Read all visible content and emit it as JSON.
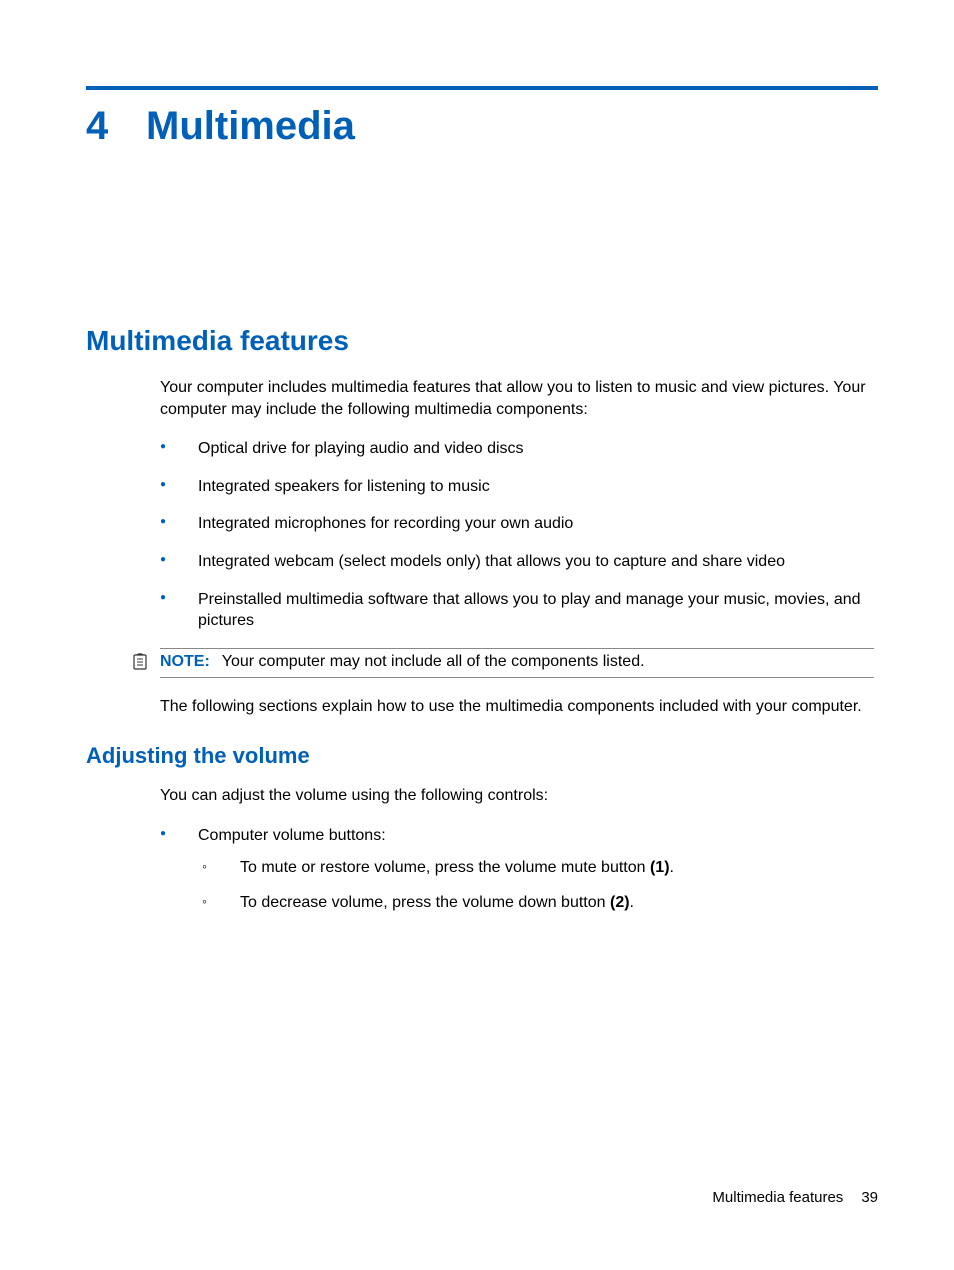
{
  "chapter": {
    "number": "4",
    "title": "Multimedia"
  },
  "section": {
    "heading": "Multimedia features"
  },
  "intro": "Your computer includes multimedia features that allow you to listen to music and view pictures. Your computer may include the following multimedia components:",
  "bullets": [
    "Optical drive for playing audio and video discs",
    "Integrated speakers for listening to music",
    "Integrated microphones for recording your own audio",
    "Integrated webcam (select models only) that allows you to capture and share video",
    "Preinstalled multimedia software that allows you to play and manage your music, movies, and pictures"
  ],
  "note": {
    "label": "NOTE:",
    "text": "Your computer may not include all of the components listed."
  },
  "after_note": "The following sections explain how to use the multimedia components included with your computer.",
  "subsection": {
    "heading": "Adjusting the volume"
  },
  "sub_intro": "You can adjust the volume using the following controls:",
  "sub_bullet_parent": "Computer volume buttons:",
  "sub_bullets": [
    {
      "prefix": "To mute or restore volume, press the volume mute button ",
      "ref": "(1)",
      "suffix": "."
    },
    {
      "prefix": "To decrease volume, press the volume down button ",
      "ref": "(2)",
      "suffix": "."
    }
  ],
  "footer": {
    "section": "Multimedia features",
    "page": "39"
  }
}
